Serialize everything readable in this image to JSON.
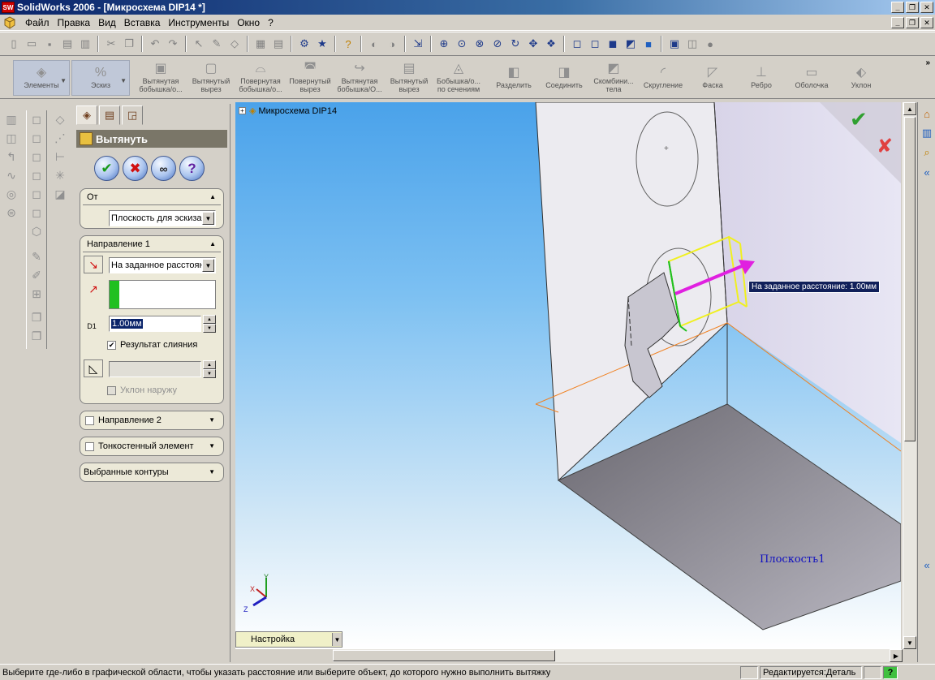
{
  "window": {
    "title": "SolidWorks 2006 - [Микросхема DIP14 *]",
    "app_icon_label": "SW"
  },
  "menu": [
    "Файл",
    "Правка",
    "Вид",
    "Вставка",
    "Инструменты",
    "Окно",
    "?"
  ],
  "command_manager": {
    "tabs": [
      {
        "label": "Элементы",
        "icon": "features-icon"
      },
      {
        "label": "Эскиз",
        "icon": "sketch-icon"
      }
    ],
    "tools": [
      {
        "label": "Вытянутая бобышка/о...",
        "icon": "extruded-boss-icon"
      },
      {
        "label": "Вытянутый вырез",
        "icon": "extruded-cut-icon"
      },
      {
        "label": "Повернутая бобышка/о...",
        "icon": "revolved-boss-icon"
      },
      {
        "label": "Повернутый вырез",
        "icon": "revolved-cut-icon"
      },
      {
        "label": "Вытянутая бобышка/О...",
        "icon": "swept-boss-icon"
      },
      {
        "label": "Вытянутый вырез",
        "icon": "swept-cut-icon"
      },
      {
        "label": "Бобышка/о... по сечениям",
        "icon": "loft-icon"
      },
      {
        "label": "Разделить",
        "icon": "split-icon"
      },
      {
        "label": "Соединить",
        "icon": "join-icon"
      },
      {
        "label": "Скомбини... тела",
        "icon": "combine-icon"
      },
      {
        "label": "Скругление",
        "icon": "fillet-icon"
      },
      {
        "label": "Фаска",
        "icon": "chamfer-icon"
      },
      {
        "label": "Ребро",
        "icon": "rib-icon"
      },
      {
        "label": "Оболочка",
        "icon": "shell-icon"
      },
      {
        "label": "Уклон",
        "icon": "draft-icon"
      }
    ]
  },
  "property_manager": {
    "title": "Вытянуть",
    "from_group": {
      "title": "От",
      "start_condition": "Плоскость для эскиза"
    },
    "direction1": {
      "title": "Направление 1",
      "end_condition": "На заданное расстояние",
      "depth": "1.00мм",
      "depth_symbol": "D1",
      "merge_label": "Результат слияния",
      "draft_outward_label": "Уклон наружу"
    },
    "direction2": {
      "title": "Направление 2"
    },
    "thin_feature": {
      "title": "Тонкостенный элемент"
    },
    "selected_contours": {
      "title": "Выбранные контуры"
    }
  },
  "graphics": {
    "tree_root": "Микросхема DIP14",
    "tooltip": "На заданное расстояние: 1.00мм",
    "plane_label": "Плоскость1",
    "config_tab": "Настройка",
    "triad": {
      "x": "X",
      "y": "Y",
      "z": "Z"
    }
  },
  "status": {
    "message": "Выберите где-либо в графической области, чтобы указать расстояние или выберите объект, до которого нужно выполнить вытяжку",
    "edit_mode": "Редактируется:Деталь",
    "help": "?"
  }
}
